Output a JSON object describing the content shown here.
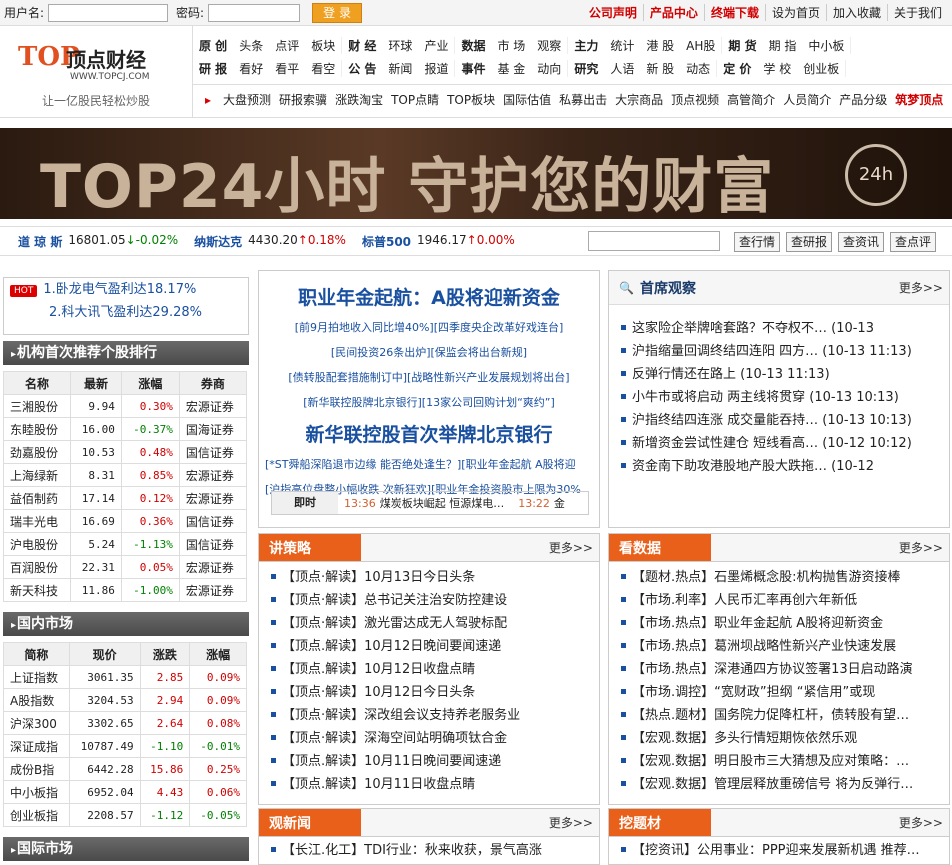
{
  "topbar": {
    "user_label": "用户名:",
    "pass_label": "密码:",
    "login": "登 录",
    "links": [
      {
        "t": "公司声明",
        "c": "red"
      },
      {
        "t": "产品中心",
        "c": "red"
      },
      {
        "t": "终端下载",
        "c": "red"
      },
      {
        "t": "设为首页",
        "c": ""
      },
      {
        "t": "加入收藏",
        "c": ""
      },
      {
        "t": "关于我们",
        "c": ""
      }
    ]
  },
  "logo": {
    "mark": "TOP",
    "name": "顶点财经",
    "url": "WWW.TOPCJ.COM",
    "slogan": "让一亿股民轻松炒股"
  },
  "nav": {
    "row1": [
      [
        "原 创",
        "头条",
        "点评",
        "板块"
      ],
      [
        "财 经",
        "环球",
        "产业"
      ],
      [
        "数据",
        "市 场",
        "观察"
      ],
      [
        "主力",
        "统计",
        "港 股",
        "AH股"
      ],
      [
        "期 货",
        "期 指",
        "中小板"
      ]
    ],
    "row2": [
      [
        "研 报",
        "看好",
        "看平",
        "看空"
      ],
      [
        "公 告",
        "新闻",
        "报道"
      ],
      [
        "事件",
        "基 金",
        "动向"
      ],
      [
        "研究",
        "人语",
        "新 股",
        "动态"
      ],
      [
        "定 价",
        "学 校",
        "创业板"
      ]
    ],
    "row3": [
      "大盘预测",
      "研报索骥",
      "涨跌淘宝",
      "TOP点睛",
      "TOP板块",
      "国际估值",
      "私募出击",
      "大宗商品",
      "顶点视频",
      "高管简介",
      "人员简介",
      "产品分级",
      "筑梦顶点"
    ]
  },
  "banner": {
    "text": "TOP24小时 守护您的财富",
    "clock": "24h"
  },
  "ticker": {
    "items": [
      {
        "name": "道 琼 斯",
        "val": "16801.05",
        "chg": "↓-0.02%",
        "dir": "dn"
      },
      {
        "name": "纳斯达克",
        "val": "4430.20",
        "chg": "↑0.18%",
        "dir": "up"
      },
      {
        "name": "标普500",
        "val": "1946.17",
        "chg": "↑0.00%",
        "dir": "up"
      }
    ],
    "buttons": [
      "查行情",
      "查研报",
      "查资讯",
      "查点评"
    ]
  },
  "hot": [
    "1.卧龙电气盈利达18.17%",
    "2.科大讯飞盈利达29.28%"
  ],
  "org": {
    "title": "机构首次推荐个股排行",
    "headers": [
      "名称",
      "最新",
      "涨幅",
      "券商"
    ],
    "rows": [
      [
        "三湘股份",
        "9.94",
        "0.30%",
        "宏源证券"
      ],
      [
        "东睦股份",
        "16.00",
        "-0.37%",
        "国海证券"
      ],
      [
        "劲嘉股份",
        "10.53",
        "0.48%",
        "国信证券"
      ],
      [
        "上海绿新",
        "8.31",
        "0.85%",
        "宏源证券"
      ],
      [
        "益佰制药",
        "17.14",
        "0.12%",
        "宏源证券"
      ],
      [
        "瑞丰光电",
        "16.69",
        "0.36%",
        "国信证券"
      ],
      [
        "沪电股份",
        "5.24",
        "-1.13%",
        "国信证券"
      ],
      [
        "百润股份",
        "22.31",
        "0.05%",
        "宏源证券"
      ],
      [
        "新天科技",
        "11.86",
        "-1.00%",
        "宏源证券"
      ]
    ]
  },
  "domestic": {
    "title": "国内市场",
    "headers": [
      "简称",
      "现价",
      "涨跌",
      "涨幅"
    ],
    "rows": [
      [
        "上证指数",
        "3061.35",
        "2.85",
        "0.09%"
      ],
      [
        "A股指数",
        "3204.53",
        "2.94",
        "0.09%"
      ],
      [
        "沪深300",
        "3302.65",
        "2.64",
        "0.08%"
      ],
      [
        "深证成指",
        "10787.49",
        "-1.10",
        "-0.01%"
      ],
      [
        "成份B指",
        "6442.28",
        "15.86",
        "0.25%"
      ],
      [
        "中小板指",
        "6952.04",
        "4.43",
        "0.06%"
      ],
      [
        "创业板指",
        "2208.57",
        "-1.12",
        "-0.05%"
      ]
    ]
  },
  "intl": {
    "title": "国际市场"
  },
  "featured": {
    "headline": "职业年金起航：A股将迎新资金",
    "lines": [
      "[前9月拍地收入同比增40%][四季度央企改革好戏连台]",
      "[民间投资26条出炉][保监会将出台新规]",
      "[债转股配套措施制订中][战略性新兴产业发展规划将出台]",
      "[新华联控股牌北京银行][13家公司回购计划“爽约”]"
    ],
    "headline2": "新华联控股首次举牌北京银行",
    "lines2": [
      "[*ST舜船深陷退市边缘 能否绝处逢生？][职业年金起航 A股将迎",
      "[沪指高位盘整小幅收跌 次新狂欢][职业年金投资股市上限为30%"
    ],
    "jishi": {
      "label": "即时",
      "t1": "13:36",
      "n1": "煤炭板块崛起 恒源煤电…",
      "t2": "13:22",
      "n2": "金"
    }
  },
  "obs": {
    "title": "首席观察",
    "more": "更多>>",
    "items": [
      "这家险企举牌啥套路？不夺权不…  (10-13",
      "沪指缩量回调终结四连阳 四方…  (10-13 11:13)",
      "反弹行情还在路上  (10-13 11:13)",
      "小牛市或将启动 两主线将贯穿  (10-13 10:13)",
      "沪指终结四连涨 成交量能吞持…  (10-13 10:13)",
      "新增资金尝试性建仓 短线看高…  (10-12 10:12)",
      "资金南下助攻港股地产股大跌拖…  (10-12"
    ]
  },
  "strat": {
    "title": "讲策略",
    "more": "更多>>",
    "items": [
      "【顶点·解读】10月13日今日头条",
      "【顶点·解读】总书记关注治安防控建设",
      "【顶点·解读】激光雷达成无人驾驶标配",
      "【顶点.解读】10月12日晚间要闻速递",
      "【顶点.解读】10月12日收盘点睛",
      "【顶点·解读】10月12日今日头条",
      "【顶点·解读】深改组会议支持养老服务业",
      "【顶点·解读】深海空间站明确项钛合金",
      "【顶点.解读】10月11日晚间要闻速递",
      "【顶点.解读】10月11日收盘点睛"
    ]
  },
  "data": {
    "title": "看数据",
    "more": "更多>>",
    "items": [
      "【题材.热点】石墨烯概念股:机构抛售游资接棒",
      "【市场.利率】人民币汇率再创六年新低",
      "【市场.热点】职业年金起航 A股将迎新资金",
      "【市场.热点】葛洲坝战略性新兴产业快速发展",
      "【市场.热点】深港通四方协议签署13日启动路演",
      "【市场.调控】“宽财政”担纲 “紧信用”或现",
      "【热点.题材】国务院力促降杠杆，债转股有望…",
      "【宏观.数据】多头行情短期恢依然乐观",
      "【宏观.数据】明日股市三大猜想及应对策略：…",
      "【宏观.数据】管理层释放重磅信号 将为反弹行…"
    ]
  },
  "news": {
    "title": "观新闻",
    "more": "更多>>",
    "items": [
      "【长江.化工】TDI行业：秋来收获，景气高涨"
    ]
  },
  "dig": {
    "title": "挖题材",
    "more": "更多>>",
    "items": [
      "【挖资讯】公用事业：PPP迎来发展新机遇 推荐…"
    ]
  }
}
